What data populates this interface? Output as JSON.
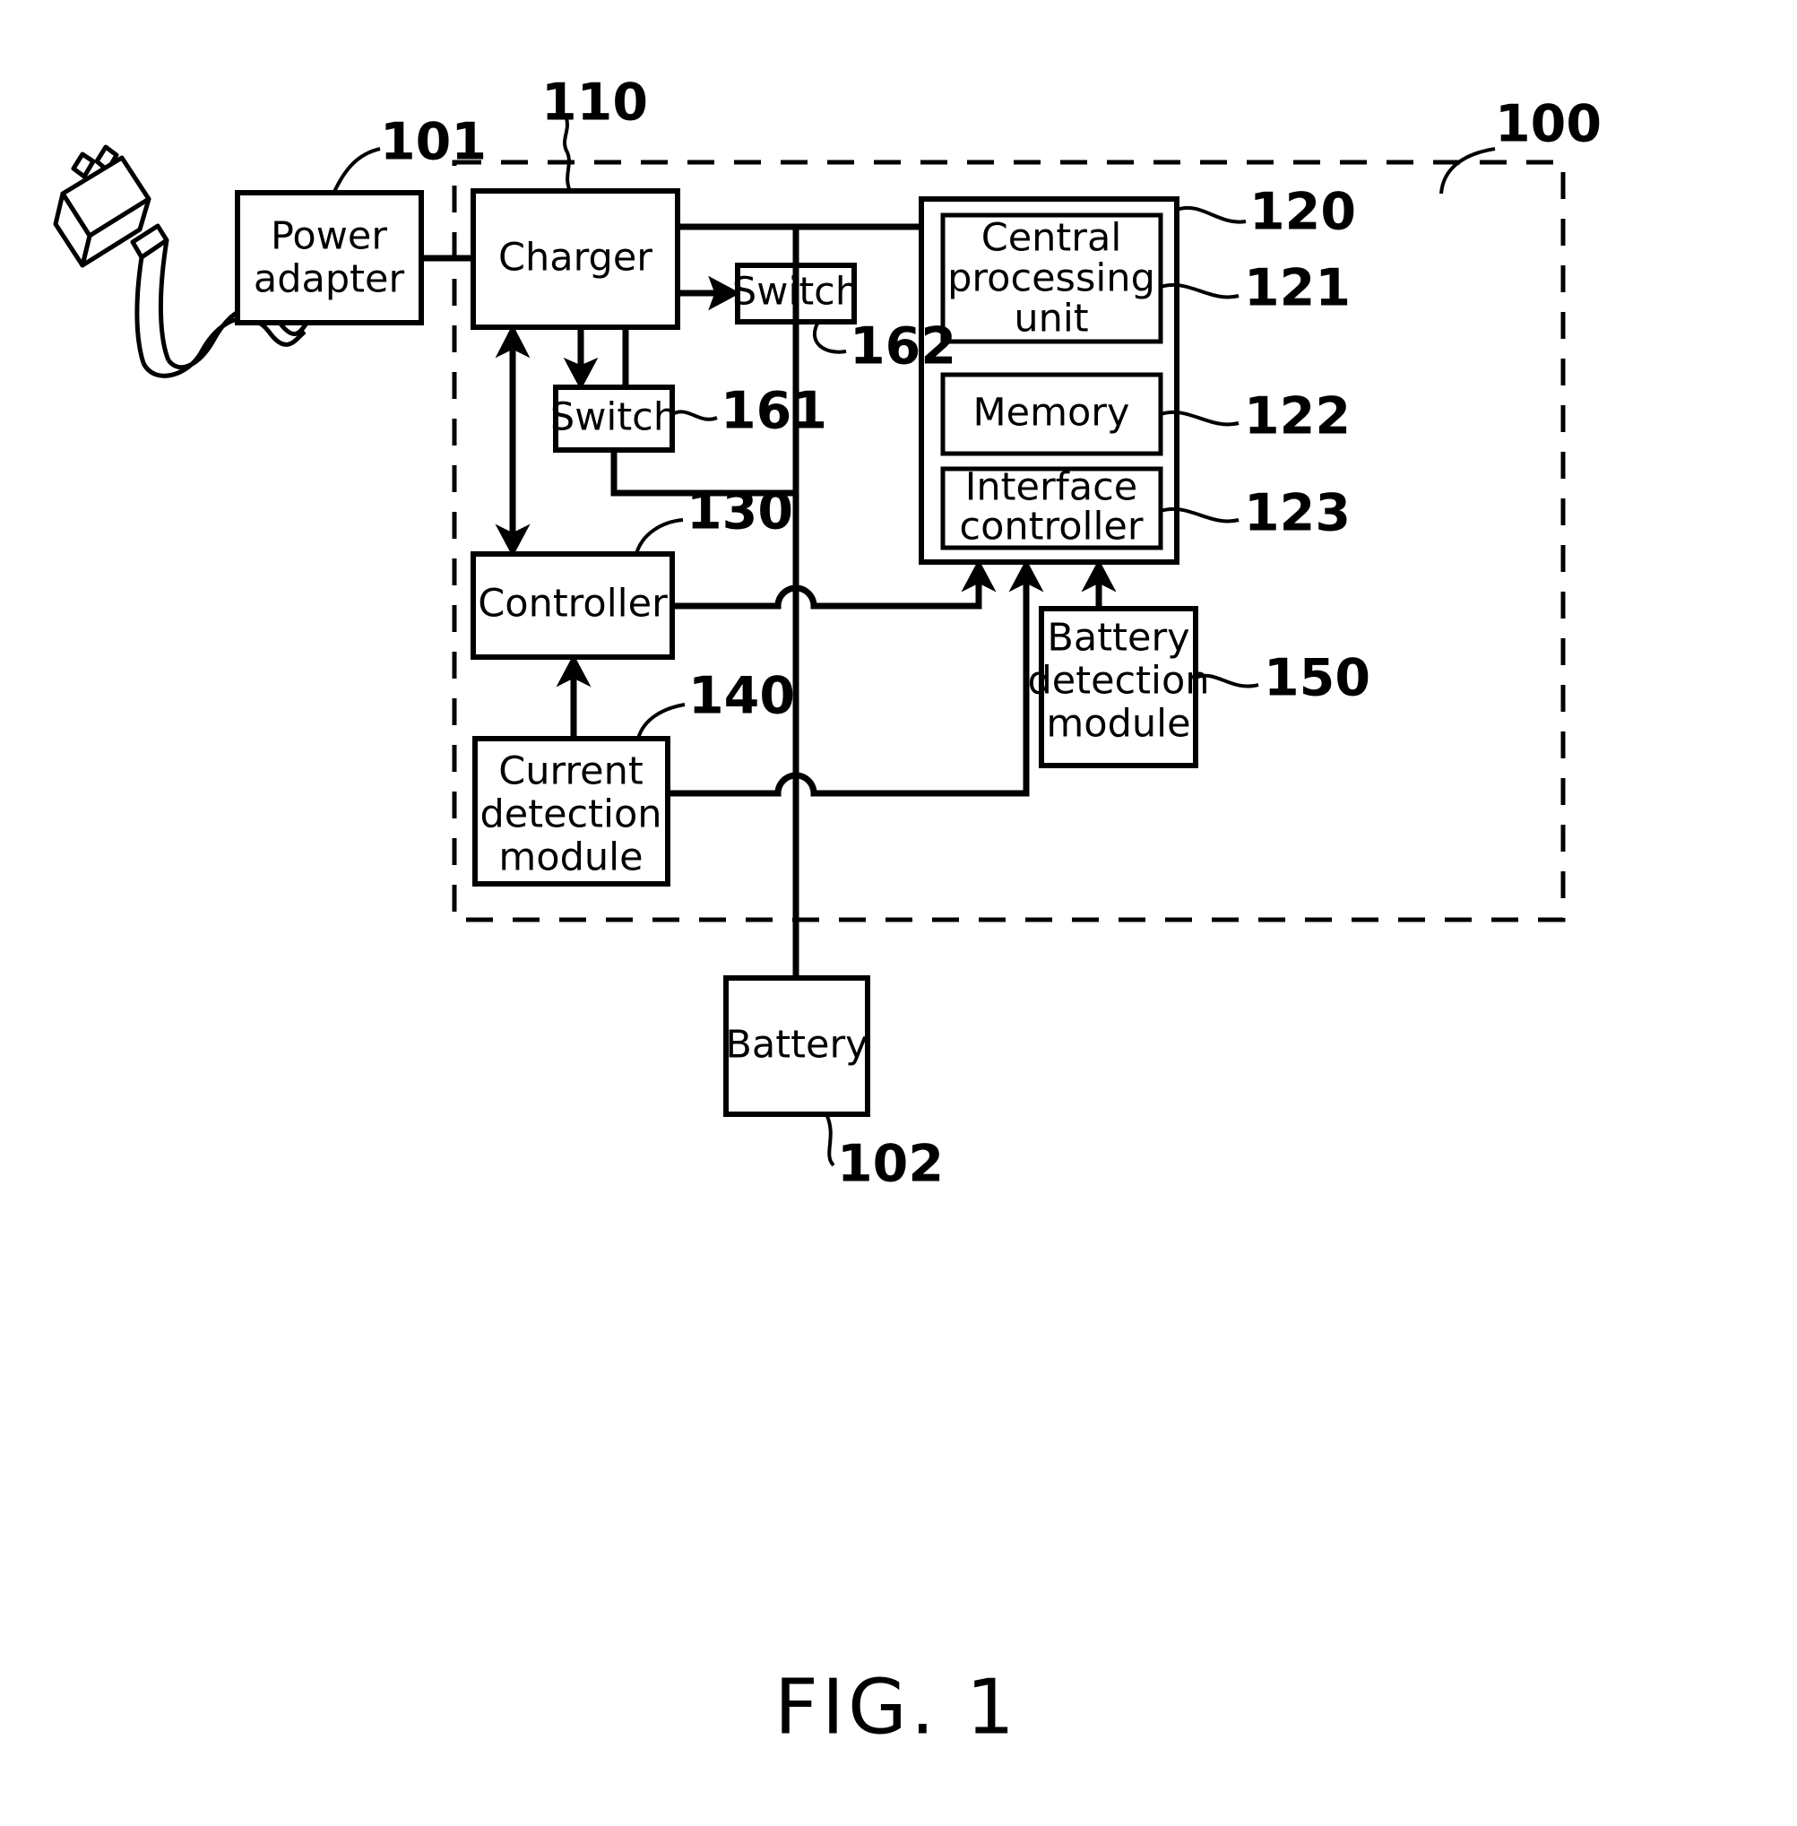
{
  "figure": {
    "caption": "FIG. 1",
    "title": "Charging system block diagram"
  },
  "blocks": {
    "power_adapter": {
      "label": "Power\nadapter",
      "line1": "Power",
      "line2": "adapter",
      "ref": "101"
    },
    "charger": {
      "label": "Charger",
      "ref": "110"
    },
    "switch_161": {
      "label": "Switch",
      "ref": "161"
    },
    "switch_162": {
      "label": "Switch",
      "ref": "162"
    },
    "controller": {
      "label": "Controller",
      "ref": "130"
    },
    "current_detection_module": {
      "line1": "Current",
      "line2": "detection",
      "line3": "module",
      "ref": "140"
    },
    "battery_detection_module": {
      "line1": "Battery",
      "line2": "detection",
      "line3": "module",
      "ref": "150"
    },
    "cpu": {
      "line1": "Central",
      "line2": "processing",
      "line3": "unit",
      "ref": "121"
    },
    "memory": {
      "label": "Memory",
      "ref": "122"
    },
    "interface_controller": {
      "line1": "Interface",
      "line2": "controller",
      "ref": "123"
    },
    "battery": {
      "label": "Battery",
      "ref": "102"
    },
    "system_group": {
      "ref": "120"
    },
    "outer_dashed_enclosure": {
      "ref": "100"
    }
  },
  "reference_numerals": [
    {
      "id": "101",
      "value": "101",
      "target": "power-adapter"
    },
    {
      "id": "110",
      "value": "110",
      "target": "charger"
    },
    {
      "id": "100",
      "value": "100",
      "target": "outer-dashed-enclosure"
    },
    {
      "id": "120",
      "value": "120",
      "target": "system-group"
    },
    {
      "id": "121",
      "value": "121",
      "target": "central-processing-unit"
    },
    {
      "id": "122",
      "value": "122",
      "target": "memory"
    },
    {
      "id": "123",
      "value": "123",
      "target": "interface-controller"
    },
    {
      "id": "161",
      "value": "161",
      "target": "switch-161"
    },
    {
      "id": "162",
      "value": "162",
      "target": "switch-162"
    },
    {
      "id": "130",
      "value": "130",
      "target": "controller"
    },
    {
      "id": "140",
      "value": "140",
      "target": "current-detection-module"
    },
    {
      "id": "150",
      "value": "150",
      "target": "battery-detection-module"
    },
    {
      "id": "102",
      "value": "102",
      "target": "battery"
    }
  ],
  "colors": {
    "ink": "#000000",
    "paper": "#ffffff"
  },
  "icons": {
    "plug": "ac-power-plug-icon"
  }
}
